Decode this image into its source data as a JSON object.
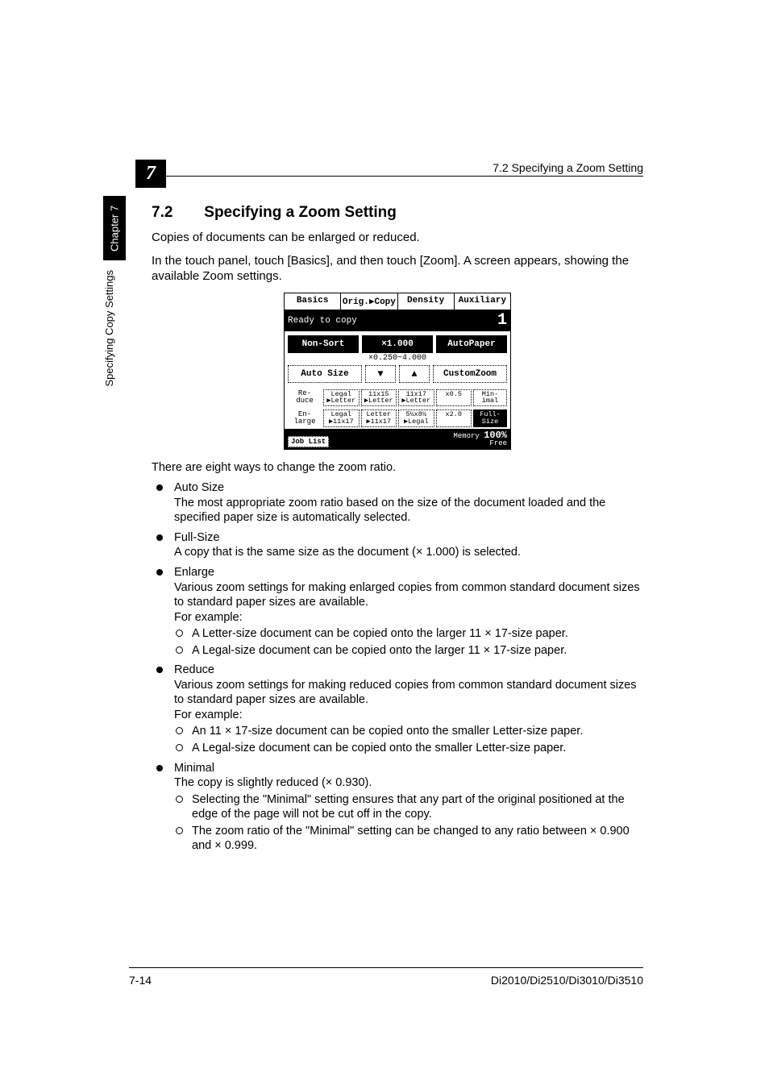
{
  "header": {
    "section_box": "7",
    "running_head": "7.2 Specifying a Zoom Setting"
  },
  "sidebar": {
    "chapter_tab": "Chapter 7",
    "section_label": "Specifying Copy Settings"
  },
  "heading": {
    "number": "7.2",
    "title": "Specifying a Zoom Setting"
  },
  "intro": {
    "p1": "Copies of documents can be enlarged or reduced.",
    "p2": "In the touch panel, touch [Basics], and then touch [Zoom]. A screen appears, showing the available Zoom settings."
  },
  "list_intro": "There are eight ways to change the zoom ratio.",
  "items": [
    {
      "title": "Auto Size",
      "desc": "The most appropriate zoom ratio based on the size of the document loaded and the specified paper size is automatically selected."
    },
    {
      "title": "Full-Size",
      "desc": "A copy that is the same size as the document (× 1.000) is selected."
    },
    {
      "title": "Enlarge",
      "desc": "Various zoom settings for making enlarged copies from common standard document sizes to standard paper sizes are available.",
      "example_lead": "For example:",
      "subs": [
        "A Letter-size document can be copied onto the larger 11 × 17-size paper.",
        "A Legal-size document can be copied onto the larger 11 × 17-size paper."
      ]
    },
    {
      "title": "Reduce",
      "desc": "Various zoom settings for making reduced copies from common standard document sizes to standard paper sizes are available.",
      "example_lead": "For example:",
      "subs": [
        "An 11 × 17-size document can be copied onto the smaller Letter-size paper.",
        "A Legal-size document can be copied onto the smaller Letter-size paper."
      ]
    },
    {
      "title": "Minimal",
      "desc": "The copy is slightly reduced (× 0.930).",
      "subs": [
        "Selecting the \"Minimal\" setting ensures that any part of the original positioned at the edge of the page will not be cut off in the copy.",
        "The zoom ratio of the \"Minimal\" setting can be changed to any ratio between × 0.900 and × 0.999."
      ]
    }
  ],
  "panel": {
    "tabs": [
      "Basics",
      "Orig.▶Copy",
      "Density",
      "Auxiliary"
    ],
    "status": "Ready to copy",
    "copies": "1",
    "row1": {
      "nonsort": "Non-Sort",
      "zoom": "×1.000",
      "autopaper": "AutoPaper"
    },
    "scale_range": "×0.250~4.000",
    "row2": {
      "autosize": "Auto Size",
      "down": "▼",
      "up": "▲",
      "custom": "CustomZoom"
    },
    "reduce": {
      "label": "Re-\nduce",
      "cells": [
        "Legal\n▶Letter",
        "11x15\n▶Letter",
        "11x17\n▶Letter",
        "x0.5"
      ],
      "min": "Min-\nimal"
    },
    "enlarge": {
      "label": "En-\nlarge",
      "cells": [
        "Legal\n▶11x17",
        "Letter\n▶11x17",
        "5½x8½\n▶Legal",
        "x2.0"
      ],
      "full": "Full-\nSize"
    },
    "footer": {
      "joblist": "Job List",
      "mem1": "Memory",
      "mem2": "Free",
      "pct": "100%"
    }
  },
  "footer": {
    "page": "7-14",
    "models": "Di2010/Di2510/Di3010/Di3510"
  }
}
